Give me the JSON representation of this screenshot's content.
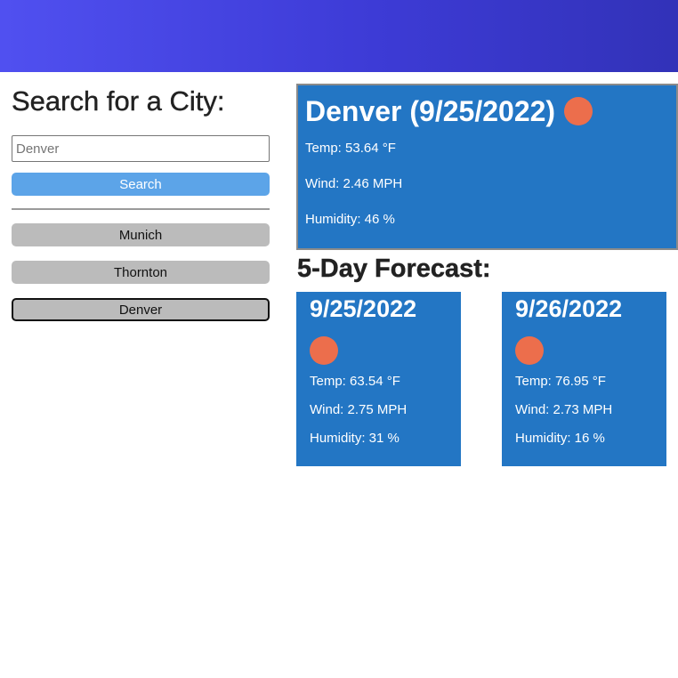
{
  "header": {
    "bg_start": "#5050f0",
    "bg_end": "#3232b8"
  },
  "sidebar": {
    "title": "Search for a City:",
    "search_value": "",
    "search_placeholder": "Denver",
    "search_button_label": "Search",
    "history": [
      "Munich",
      "Thornton",
      "Denver"
    ],
    "active_history": "Denver"
  },
  "current": {
    "title": "Denver (9/25/2022)",
    "icon": "weather-icon",
    "temp": "Temp: 53.64 °F",
    "wind": "Wind: 2.46 MPH",
    "humidity": "Humidity: 46 %"
  },
  "forecast": {
    "title": "5-Day Forecast:",
    "days": [
      {
        "date": "9/25/2022",
        "icon": "weather-icon",
        "temp": "Temp: 63.54 °F",
        "wind": "Wind: 2.75 MPH",
        "humidity": "Humidity: 31 %"
      },
      {
        "date": "9/26/2022",
        "icon": "weather-icon",
        "temp": "Temp: 76.95 °F",
        "wind": "Wind: 2.73 MPH",
        "humidity": "Humidity: 16 %"
      }
    ]
  },
  "colors": {
    "card_bg": "#2376c4",
    "button_bg": "#5ca4e8",
    "icon_color": "#ec6e4c"
  }
}
